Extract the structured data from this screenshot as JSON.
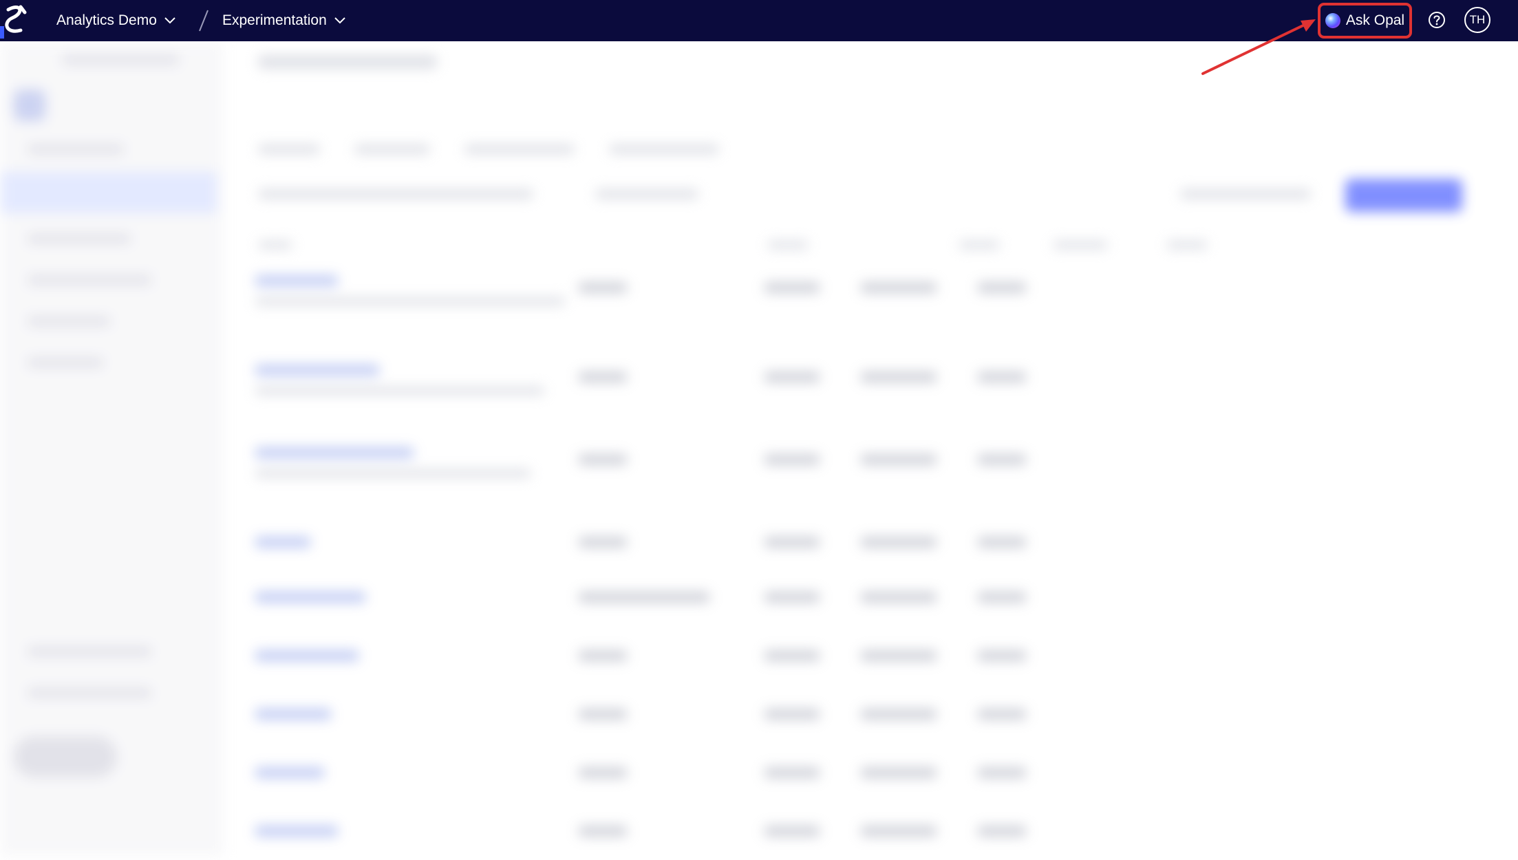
{
  "header": {
    "workspace_label": "Analytics Demo",
    "section_label": "Experimentation",
    "ask_label": "Ask Opal",
    "avatar_initials": "TH",
    "icons": {
      "logo": "app-logo-icon",
      "workspace_dropdown": "chevron-down-icon",
      "section_dropdown": "chevron-down-icon",
      "separator": "slash-separator-icon",
      "ask": "opal-orb-icon",
      "help": "help-circle-icon"
    }
  },
  "colors": {
    "topbar_bg": "#0b0b3d",
    "highlight": "#e03232",
    "primary": "#6b7cff"
  },
  "annotation": {
    "type": "arrow",
    "target": "ask-opal-button"
  }
}
